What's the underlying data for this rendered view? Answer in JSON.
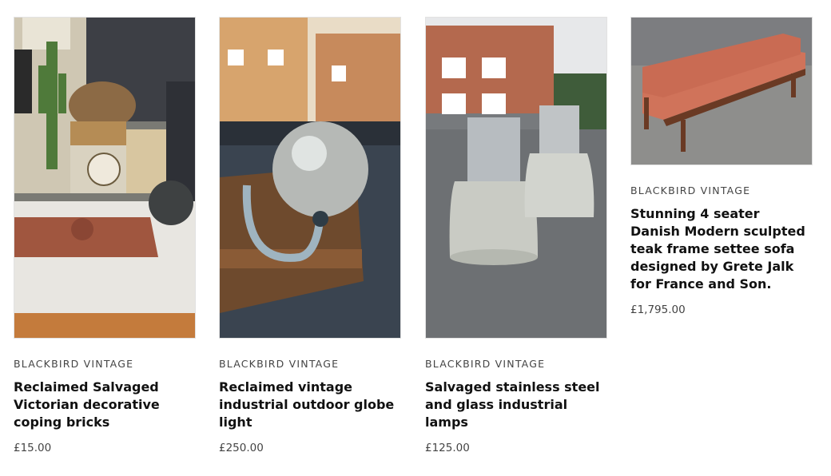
{
  "products": [
    {
      "vendor": "BLACKBIRD VINTAGE",
      "title": "Reclaimed Salvaged Victorian decorative coping bricks",
      "price": "£15.00",
      "image_icon": "coping-bricks-photo"
    },
    {
      "vendor": "BLACKBIRD VINTAGE",
      "title": "Reclaimed vintage industrial outdoor globe light",
      "price": "£250.00",
      "image_icon": "globe-light-photo"
    },
    {
      "vendor": "BLACKBIRD VINTAGE",
      "title": "Salvaged stainless steel and glass industrial lamps",
      "price": "£125.00",
      "image_icon": "industrial-lamps-photo"
    },
    {
      "vendor": "BLACKBIRD VINTAGE",
      "title": "Stunning 4 seater Danish Modern sculpted teak frame settee sofa designed by Grete Jalk for France and Son.",
      "price": "£1,795.00",
      "image_icon": "danish-sofa-photo"
    }
  ]
}
